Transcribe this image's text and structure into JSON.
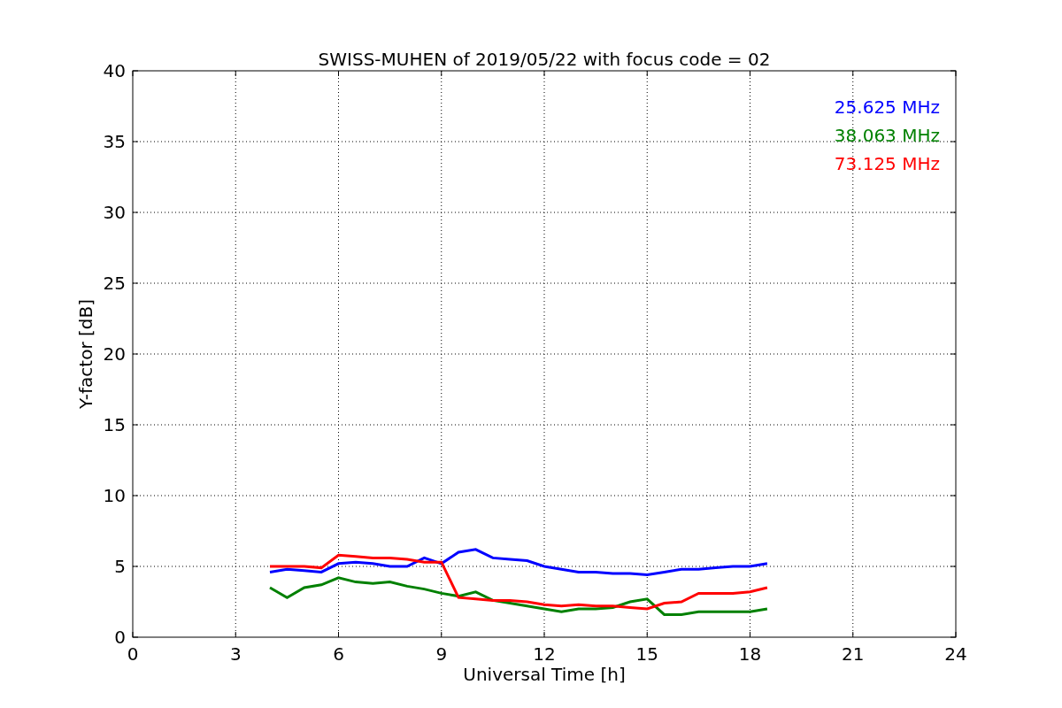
{
  "figure": {
    "chart_data": {
      "type": "line",
      "title": "SWISS-MUHEN of 2019/05/22 with focus code = 02",
      "xlabel": "Universal Time [h]",
      "ylabel": "Y-factor [dB]",
      "x": [
        4,
        4.5,
        5,
        5.5,
        6,
        6.5,
        7,
        7.5,
        8,
        8.5,
        9,
        9.5,
        10,
        10.5,
        11,
        11.5,
        12,
        12.5,
        13,
        13.5,
        14,
        14.5,
        15,
        15.5,
        16,
        16.5,
        17,
        17.5,
        18,
        18.5
      ],
      "series": [
        {
          "name": "25.625 MHz",
          "color": "#0000ff",
          "values": [
            4.6,
            4.8,
            4.7,
            4.6,
            5.2,
            5.3,
            5.2,
            5.0,
            5.0,
            5.6,
            5.2,
            6.0,
            6.2,
            5.6,
            5.5,
            5.4,
            5.0,
            4.8,
            4.6,
            4.6,
            4.5,
            4.5,
            4.4,
            4.6,
            4.8,
            4.8,
            4.9,
            5.0,
            5.0,
            5.2
          ]
        },
        {
          "name": "38.063 MHz",
          "color": "#008000",
          "values": [
            3.5,
            2.8,
            3.5,
            3.7,
            4.2,
            3.9,
            3.8,
            3.9,
            3.6,
            3.4,
            3.1,
            2.9,
            3.2,
            2.6,
            2.4,
            2.2,
            2.0,
            1.8,
            2.0,
            2.0,
            2.1,
            2.5,
            2.7,
            1.6,
            1.6,
            1.8,
            1.8,
            1.8,
            1.8,
            2.0
          ]
        },
        {
          "name": "73.125 MHz",
          "color": "#ff0000",
          "values": [
            5.0,
            5.0,
            5.0,
            4.9,
            5.8,
            5.7,
            5.6,
            5.6,
            5.5,
            5.3,
            5.3,
            2.8,
            2.7,
            2.6,
            2.6,
            2.5,
            2.3,
            2.2,
            2.3,
            2.2,
            2.2,
            2.1,
            2.0,
            2.4,
            2.5,
            3.1,
            3.1,
            3.1,
            3.2,
            3.5
          ]
        }
      ],
      "grid": true,
      "xlim": [
        0,
        24
      ],
      "ylim": [
        0,
        40
      ],
      "xticks": [
        0,
        3,
        6,
        9,
        12,
        15,
        18,
        21,
        24
      ],
      "yticks": [
        0,
        5,
        10,
        15,
        20,
        25,
        30,
        35,
        40
      ]
    }
  }
}
